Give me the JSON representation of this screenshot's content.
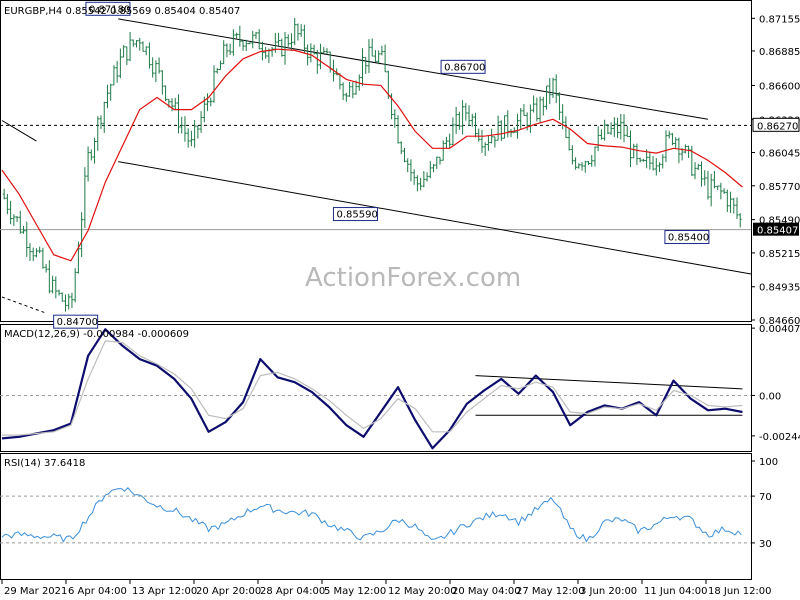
{
  "colors": {
    "background": "#ffffff",
    "candles": "#1e7a46",
    "ma_line": "#e01010",
    "macd_line": "#0d0d6e",
    "signal_line": "#bdbdbd",
    "rsi_line": "#3b8fd9",
    "channel": "#000000",
    "grid_level": "#000000"
  },
  "header": {
    "price_title": "EURGBP,H4  0.85542 0.85569 0.85404 0.85407",
    "macd_title": "MACD(12,26,9) -0.000984 -0.000609",
    "rsi_title": "RSI(14) 37.6418"
  },
  "watermark": "ActionForex.com",
  "chart_data": [
    {
      "panel": "price",
      "type": "bar",
      "title": "EURGBP,H4",
      "ohlc_last": {
        "open": 0.85542,
        "high": 0.85569,
        "low": 0.85404,
        "close": 0.85407
      },
      "y_ticks": [
        "0.87155",
        "0.86885",
        "0.86600",
        "0.86320",
        "0.86045",
        "0.85770",
        "0.85490",
        "0.85215",
        "0.84935",
        "0.84660"
      ],
      "ylim": [
        0.8466,
        0.8729
      ],
      "current_price_label": "0.85407",
      "level_label": "0.86270",
      "level": 0.8627,
      "annotations": [
        {
          "text": "0.87180",
          "x": 19.5,
          "y": 0.8718
        },
        {
          "text": "0.86700",
          "x": 102,
          "y": 0.867
        },
        {
          "text": "0.85590",
          "x": 77,
          "y": 0.8559
        },
        {
          "text": "0.85400",
          "x": 154,
          "y": 0.854
        },
        {
          "text": "0.84700",
          "x": 12,
          "y": 0.847
        }
      ],
      "channel": {
        "upper": [
          [
            27,
            0.8715
          ],
          [
            164,
            0.8632
          ]
        ],
        "lower": [
          [
            27,
            0.8597
          ],
          [
            174,
            0.8504
          ]
        ],
        "prior_upper": [
          [
            0,
            0.8631
          ],
          [
            8,
            0.8614
          ]
        ],
        "prior_lower": [
          [
            0,
            0.8485
          ],
          [
            10,
            0.8472
          ]
        ]
      },
      "x_tick_labels": [
        "29 Mar 2021",
        "6 Apr 04:00",
        "13 Apr 12:00",
        "20 Apr 20:00",
        "28 Apr 04:00",
        "5 May 12:00",
        "12 May 20:00",
        "20 May 04:00",
        "27 May 12:00",
        "3 Jun 20:00",
        "11 Jun 04:00",
        "18 Jun 12:00"
      ],
      "series_x": [
        0,
        4,
        8,
        12,
        16,
        20,
        24,
        28,
        32,
        36,
        40,
        44,
        48,
        52,
        56,
        60,
        64,
        68,
        72,
        76,
        80,
        84,
        88,
        92,
        96,
        100,
        104,
        108,
        112,
        116,
        120,
        124,
        128,
        132,
        136,
        140,
        144,
        148,
        152,
        156,
        160,
        164,
        168,
        172
      ],
      "close": [
        0.857,
        0.8545,
        0.852,
        0.849,
        0.8475,
        0.86,
        0.865,
        0.8685,
        0.87,
        0.8672,
        0.864,
        0.861,
        0.865,
        0.869,
        0.87,
        0.8695,
        0.8688,
        0.8705,
        0.8685,
        0.868,
        0.865,
        0.8682,
        0.8684,
        0.862,
        0.8578,
        0.8588,
        0.862,
        0.864,
        0.8615,
        0.8625,
        0.863,
        0.8637,
        0.866,
        0.8598,
        0.86,
        0.862,
        0.8625,
        0.859,
        0.86,
        0.862,
        0.8595,
        0.8575,
        0.857,
        0.8545
      ],
      "ma": [
        0.859,
        0.857,
        0.8545,
        0.852,
        0.8515,
        0.854,
        0.858,
        0.861,
        0.864,
        0.865,
        0.864,
        0.864,
        0.865,
        0.8668,
        0.8682,
        0.8688,
        0.869,
        0.8689,
        0.8685,
        0.8675,
        0.8665,
        0.8661,
        0.866,
        0.8643,
        0.8622,
        0.8608,
        0.8608,
        0.8618,
        0.8618,
        0.862,
        0.8623,
        0.8628,
        0.8632,
        0.8624,
        0.8612,
        0.861,
        0.8609,
        0.8606,
        0.8604,
        0.8608,
        0.8606,
        0.8598,
        0.8588,
        0.8576
      ]
    },
    {
      "panel": "macd",
      "type": "line",
      "title": "MACD(12,26,9)",
      "values_text": "-0.000984 -0.000609",
      "y_ticks": [
        "0.004071",
        "0.00",
        "-0.002445"
      ],
      "y_tick_values": [
        0.004071,
        0.0,
        -0.002445
      ],
      "ylim": [
        -0.0033,
        0.0042
      ],
      "series_x": [
        0,
        4,
        8,
        12,
        16,
        20,
        24,
        28,
        32,
        36,
        40,
        44,
        48,
        52,
        56,
        60,
        64,
        68,
        72,
        76,
        80,
        84,
        88,
        92,
        96,
        100,
        104,
        108,
        112,
        116,
        120,
        124,
        128,
        132,
        136,
        140,
        144,
        148,
        152,
        156,
        160,
        164,
        168,
        172
      ],
      "series": [
        {
          "name": "MACD",
          "values": [
            -0.0026,
            -0.0025,
            -0.0023,
            -0.0021,
            -0.0017,
            0.0024,
            0.004,
            0.003,
            0.0022,
            0.0018,
            0.001,
            -0.0002,
            -0.0022,
            -0.0016,
            -0.0004,
            0.0022,
            0.0011,
            0.0008,
            0.0002,
            -0.0007,
            -0.0018,
            -0.0025,
            -0.001,
            0.0005,
            -0.0015,
            -0.0032,
            -0.0021,
            -0.0005,
            0.0003,
            0.001,
            0.0001,
            0.0012,
            0.0002,
            -0.0018,
            -0.001,
            -0.0006,
            -0.0008,
            -0.0004,
            -0.0012,
            0.0009,
            -0.0002,
            -0.0009,
            -0.0008,
            -0.001
          ]
        },
        {
          "name": "Signal",
          "values": [
            -0.0024,
            -0.0024,
            -0.0023,
            -0.0022,
            -0.0018,
            0.001,
            0.0033,
            0.0032,
            0.0024,
            0.0019,
            0.0013,
            0.0004,
            -0.0012,
            -0.0014,
            -0.0008,
            0.0012,
            0.0014,
            0.001,
            0.0004,
            -0.0003,
            -0.0012,
            -0.002,
            -0.0014,
            -0.0002,
            -0.0008,
            -0.0022,
            -0.0022,
            -0.001,
            -0.0002,
            0.0006,
            0.0004,
            0.0008,
            0.0005,
            -0.001,
            -0.0011,
            -0.0007,
            -0.0008,
            -0.0005,
            -0.0009,
            0.0003,
            0.0,
            -0.0006,
            -0.0007,
            -0.0006
          ]
        }
      ],
      "trendlines": {
        "upper": [
          [
            110,
            0.0012
          ],
          [
            172,
            0.0004
          ]
        ],
        "lower": [
          [
            110,
            -0.0012
          ],
          [
            172,
            -0.0012
          ]
        ]
      }
    },
    {
      "panel": "rsi",
      "type": "line",
      "title": "RSI(14)",
      "values_text": "37.6418",
      "y_ticks": [
        "100",
        "70",
        "30"
      ],
      "y_tick_values": [
        100,
        70,
        30
      ],
      "ylim": [
        0,
        100
      ],
      "levels": [
        70,
        30
      ],
      "series_x": [
        0,
        4,
        8,
        12,
        16,
        20,
        24,
        28,
        32,
        36,
        40,
        44,
        48,
        52,
        56,
        60,
        64,
        68,
        72,
        76,
        80,
        84,
        88,
        92,
        96,
        100,
        104,
        108,
        112,
        116,
        120,
        124,
        128,
        132,
        136,
        140,
        144,
        148,
        152,
        156,
        160,
        164,
        168,
        172
      ],
      "series": [
        {
          "name": "RSI",
          "values": [
            36,
            37,
            36,
            35,
            33,
            52,
            72,
            78,
            70,
            62,
            58,
            50,
            42,
            46,
            55,
            62,
            58,
            56,
            55,
            46,
            40,
            34,
            40,
            50,
            44,
            30,
            38,
            46,
            52,
            56,
            48,
            58,
            68,
            42,
            32,
            48,
            50,
            40,
            46,
            54,
            50,
            37,
            42,
            38
          ]
        }
      ]
    }
  ]
}
